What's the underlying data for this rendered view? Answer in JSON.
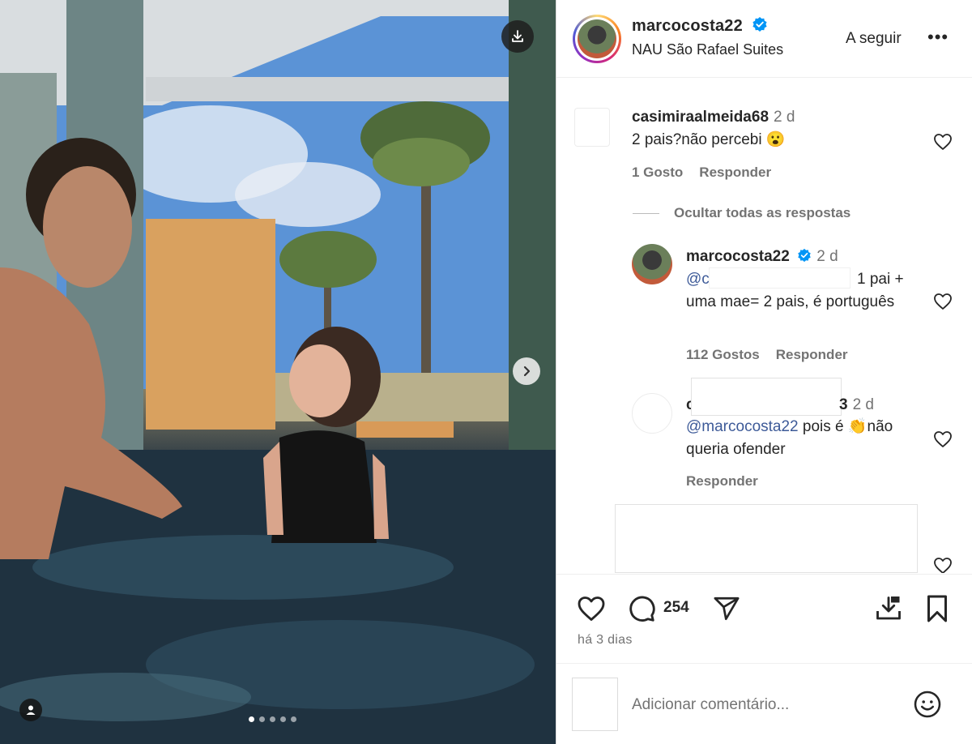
{
  "post": {
    "author": "marcocosta22",
    "location": "NAU São Rafael Suites",
    "follow_label": "A seguir",
    "more_label": "•••",
    "time_ago": "há 3 dias",
    "comment_count": "254",
    "carousel": {
      "total_slides": 5,
      "active_index": 0
    }
  },
  "comments": [
    {
      "user": "casimiraalmeida68",
      "time": "2 d",
      "text": "2 pais?não percebi 😮",
      "likes": "1 Gosto",
      "reply_label": "Responder"
    }
  ],
  "hide_replies_label": "Ocultar todas as respostas",
  "replies": [
    {
      "user": "marcocosta22",
      "time": "2 d",
      "mention": "@c",
      "text_line1": "1 pai +",
      "text_rest": "uma mae= 2 pais, é português",
      "likes": "112 Gostos",
      "reply_label": "Responder"
    },
    {
      "user_partial": "c",
      "user_tail": "3",
      "time": "2 d",
      "mention": "@marcocosta22",
      "text": " pois é 👏não queria ofender",
      "reply_label": "Responder"
    }
  ],
  "composer": {
    "placeholder": "Adicionar comentário..."
  },
  "icons": {
    "download": "download-icon",
    "next": "chevron-right-icon",
    "user_tag": "person-icon",
    "verified": "verified-badge-icon",
    "heart": "heart-icon",
    "comment": "comment-icon",
    "share": "send-icon",
    "save_download": "save-download-icon",
    "bookmark": "bookmark-icon",
    "emoji": "emoji-icon"
  },
  "colors": {
    "verified": "#0095f6",
    "mention": "#3d5a98",
    "muted": "#737373"
  }
}
